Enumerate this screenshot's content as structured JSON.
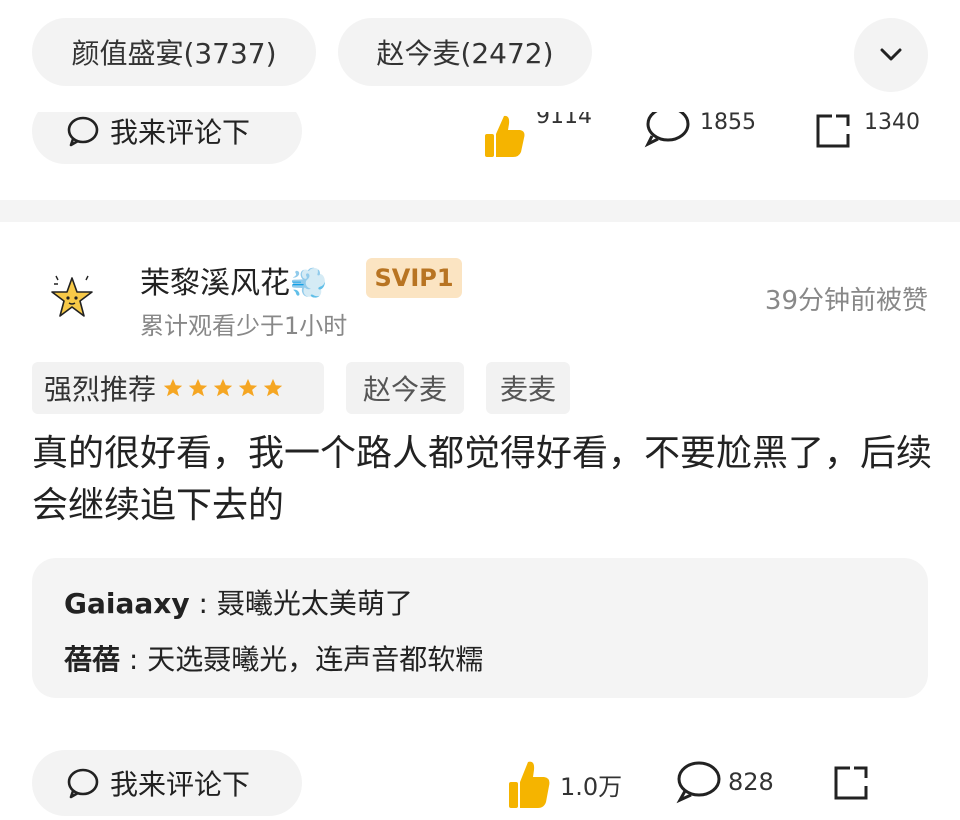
{
  "chips": [
    {
      "label": "颜值盛宴(3737)"
    },
    {
      "label": "赵今麦(2472)"
    }
  ],
  "previous_post": {
    "comment_label": "我来评论下",
    "likes": "9114",
    "comments": "1855",
    "shares": "1340"
  },
  "post": {
    "username": "茉黎溪风花💨",
    "badge": "SVIP1",
    "watch_time": "累计观看少于1小时",
    "liked_time": "39分钟前被赞",
    "rating_label": "强烈推荐",
    "rating_stars": 5,
    "tags": [
      "赵今麦",
      "麦麦"
    ],
    "text": "真的很好看，我一个路人都觉得好看，不要尬黑了，后续会继续追下去的",
    "replies": [
      {
        "name": "Gaiaaxy",
        "sep": " : ",
        "text": "聂曦光太美萌了"
      },
      {
        "name": "蓓蓓",
        "sep": " : ",
        "text": "天选聂曦光，连声音都软糯"
      }
    ],
    "comment_label": "我来评论下",
    "likes": "1.0万",
    "comments": "828"
  },
  "colors": {
    "accent_star": "#f5a623",
    "badge_bg": "#fbe4c2",
    "badge_text": "#b87422"
  }
}
